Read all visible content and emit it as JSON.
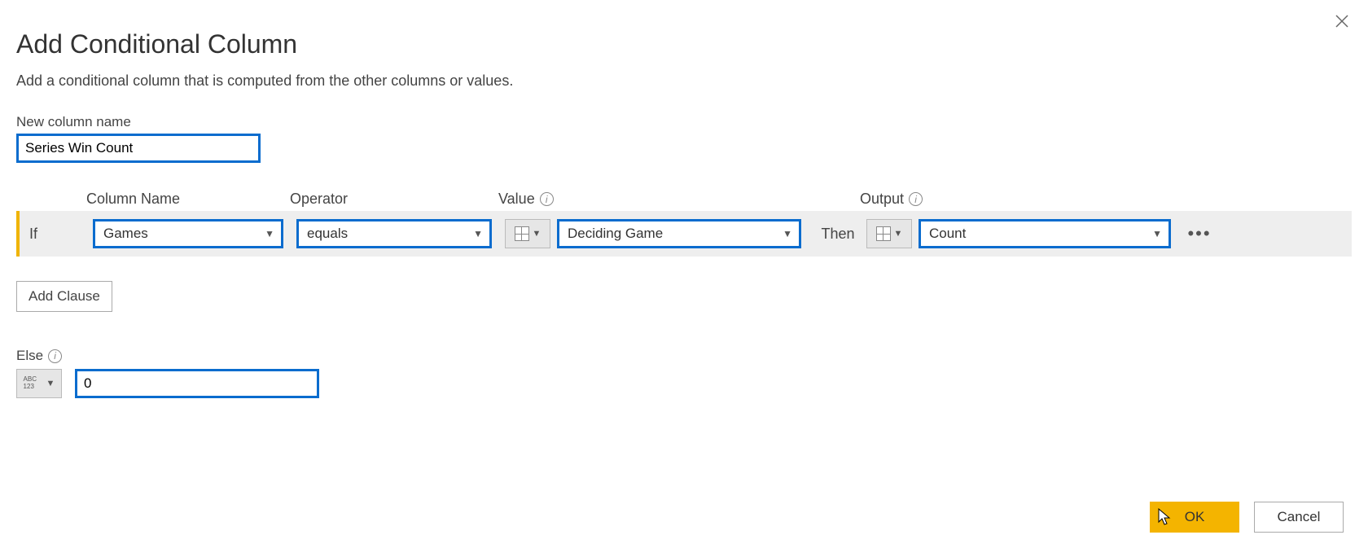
{
  "dialog": {
    "title": "Add Conditional Column",
    "subtitle": "Add a conditional column that is computed from the other columns or values.",
    "new_column_label": "New column name",
    "new_column_value": "Series Win Count",
    "headers": {
      "column_name": "Column Name",
      "operator": "Operator",
      "value": "Value",
      "output": "Output"
    },
    "rule": {
      "if_label": "If",
      "column_name": "Games",
      "operator": "equals",
      "value_type": "column",
      "value": "Deciding Game",
      "then_label": "Then",
      "output_type": "column",
      "output": "Count",
      "more": "•••"
    },
    "add_clause_label": "Add Clause",
    "else_label": "Else",
    "else_type": "abc123",
    "else_value": "0",
    "ok_label": "OK",
    "cancel_label": "Cancel"
  }
}
